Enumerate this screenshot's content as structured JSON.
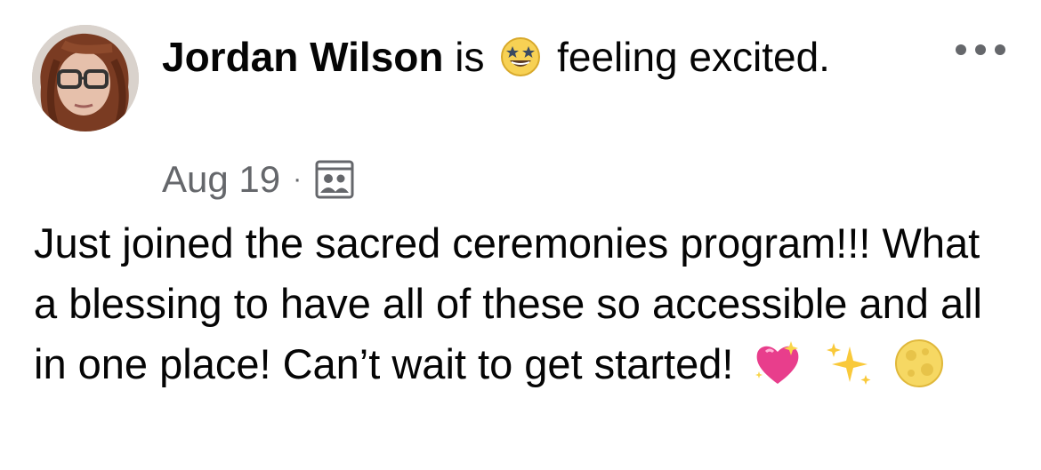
{
  "post": {
    "author": {
      "name": "Jordan Wilson",
      "avatar_icon": "profile-photo"
    },
    "activity": {
      "prefix": "is",
      "emoji_icon": "star-struck-emoji",
      "text": "feeling excited."
    },
    "timestamp": "Aug 19",
    "separator": "·",
    "audience_icon": "group-audience-icon",
    "more_icon": "more-options-icon",
    "body_text": "Just joined the sacred ceremonies program!!! What a blessing to have all of these so accessible and all in one place! Can’t wait to get started!",
    "body_emojis": [
      "sparkling-heart-emoji",
      "sparkles-emoji",
      "full-moon-emoji"
    ]
  }
}
